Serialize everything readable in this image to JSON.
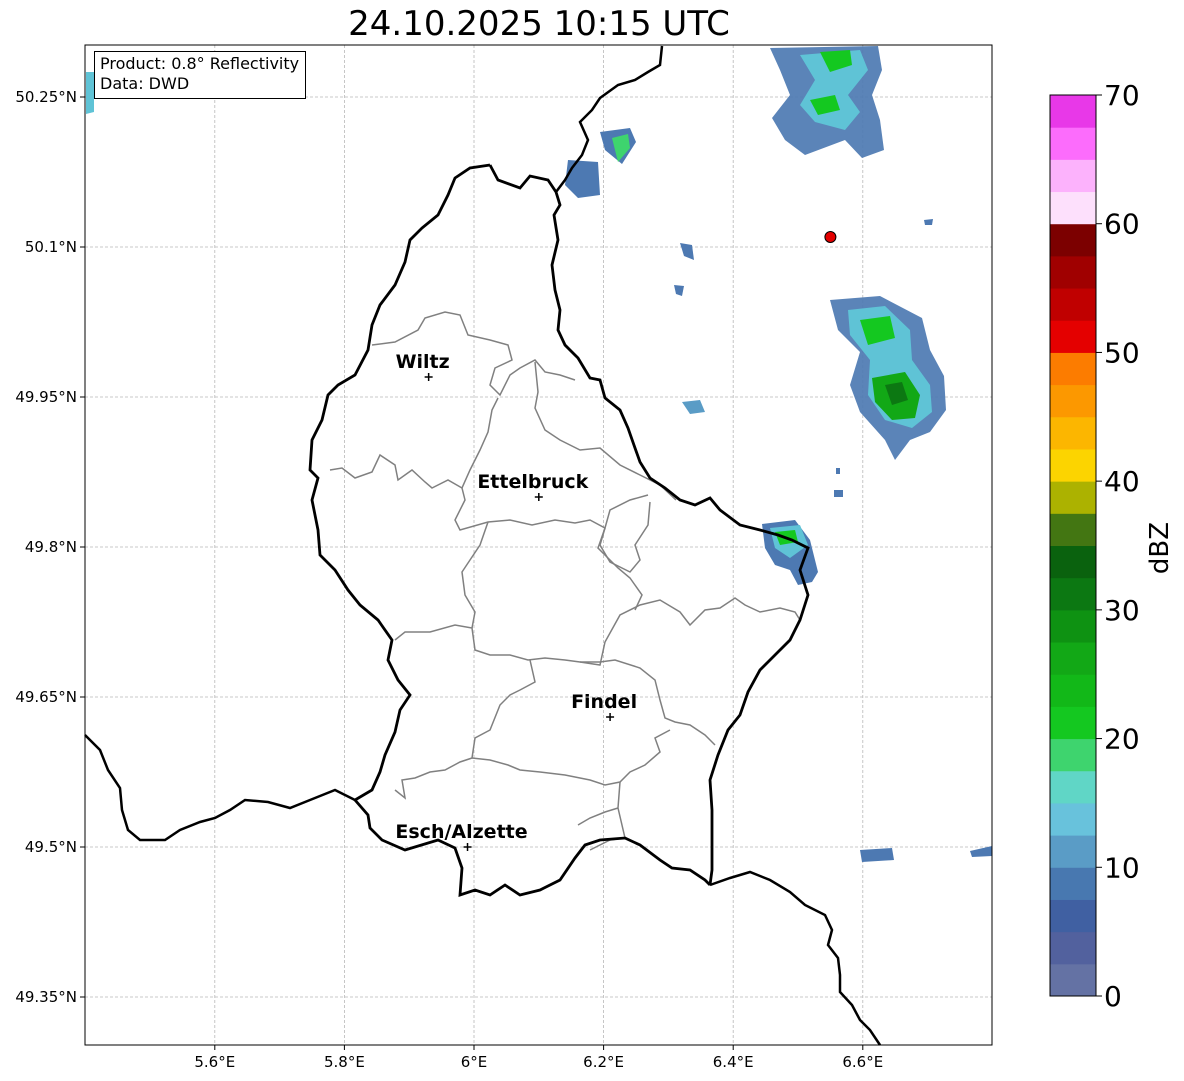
{
  "title": "24.10.2025 10:15 UTC",
  "info_box": {
    "product": "Product: 0.8° Reflectivity",
    "data": "Data: DWD"
  },
  "axes": {
    "lon_ticks": [
      "5.6°E",
      "5.8°E",
      "6°E",
      "6.2°E",
      "6.4°E",
      "6.6°E"
    ],
    "lat_ticks": [
      "50.25°N",
      "50.1°N",
      "49.95°N",
      "49.8°N",
      "49.65°N",
      "49.5°N",
      "49.35°N"
    ]
  },
  "cities": [
    {
      "name": "Wiltz",
      "lon": 5.93,
      "lat": 49.97
    },
    {
      "name": "Ettelbruck",
      "lon": 6.1,
      "lat": 49.85
    },
    {
      "name": "Findel",
      "lon": 6.21,
      "lat": 49.63
    },
    {
      "name": "Esch/Alzette",
      "lon": 5.99,
      "lat": 49.5
    }
  ],
  "colorbar": {
    "label": "dBZ",
    "tick_labels": [
      "0",
      "10",
      "20",
      "30",
      "40",
      "50",
      "60",
      "70"
    ],
    "range": [
      0,
      70
    ],
    "step": 2.5,
    "colors": [
      "#6472a4",
      "#52619e",
      "#4060a2",
      "#4878b0",
      "#5a9cc6",
      "#68c2dc",
      "#60d6c6",
      "#3ed46e",
      "#14c820",
      "#12b818",
      "#12a816",
      "#0e9212",
      "#0c7812",
      "#0a620e",
      "#437612",
      "#acb200",
      "#fcd400",
      "#fcb600",
      "#fc9800",
      "#fc7c00",
      "#e40000",
      "#c00000",
      "#a00000",
      "#7c0000",
      "#fde0fc",
      "#fcb2fc",
      "#fc6cfc",
      "#e838e8"
    ]
  },
  "marker": {
    "lon": 6.55,
    "lat": 50.11,
    "color": "#e30000"
  }
}
